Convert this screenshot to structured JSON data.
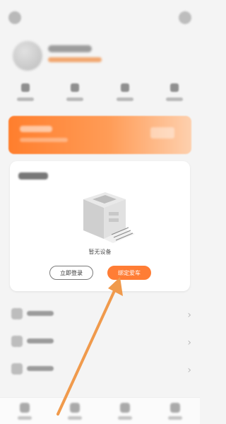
{
  "card": {
    "empty_text": "暂无设备",
    "login_button": "立即登录",
    "bind_button": "绑定爱车"
  },
  "colors": {
    "accent": "#ff7d35",
    "annotation_arrow": "#f09a4c"
  },
  "icons": {
    "settings": "settings-icon",
    "message": "message-icon",
    "device": "device-icon"
  }
}
